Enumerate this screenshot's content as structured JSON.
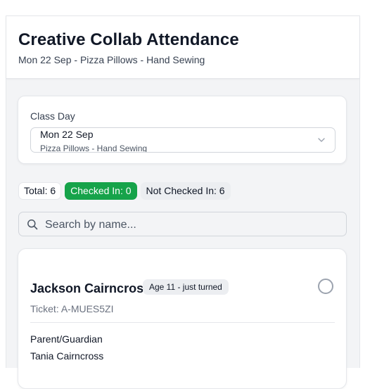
{
  "header": {
    "title": "Creative Collab Attendance",
    "subtitle": "Mon 22 Sep - Pizza Pillows - Hand Sewing"
  },
  "class_select": {
    "label": "Class Day",
    "selected_day": "Mon 22 Sep",
    "selected_class": "Pizza Pillows - Hand Sewing"
  },
  "stats": {
    "total": "Total: 6",
    "checked_in": "Checked In: 0",
    "not_checked_in": "Not Checked In: 6"
  },
  "search": {
    "placeholder": "Search by name...",
    "value": ""
  },
  "students": [
    {
      "name": "Jackson Cairncross",
      "age": "Age 11 - just turned",
      "ticket": "Ticket: A-MUES5ZI",
      "guardian_label": "Parent/Guardian",
      "guardian_name": "Tania Cairncross",
      "checked_in": false
    }
  ],
  "colors": {
    "accent_green": "#16a34a",
    "background": "#f3f4f6",
    "card": "#ffffff"
  },
  "icons": {
    "select": "chevron-down-icon",
    "search": "search-icon",
    "check": "circle-check-icon"
  }
}
